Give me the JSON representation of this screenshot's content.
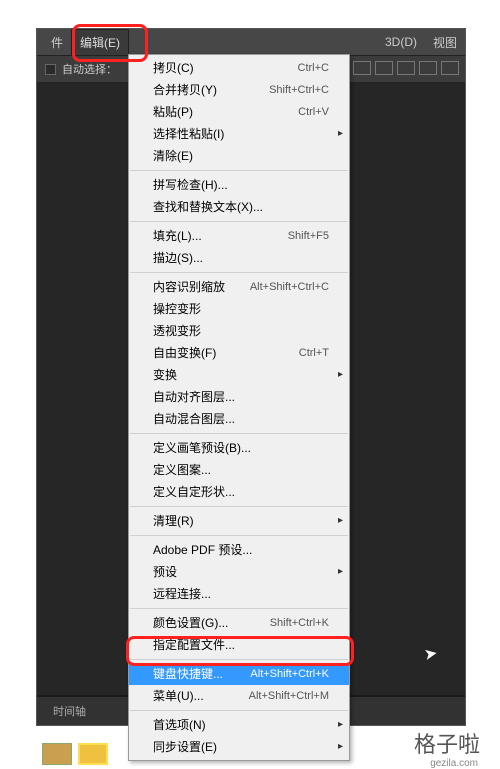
{
  "menubar": {
    "file": "件",
    "edit": "编辑(E)",
    "threeD": "3D(D)",
    "view": "视图"
  },
  "toolbar": {
    "autoSelect": "自动选择：",
    "timeline": "时间轴"
  },
  "menu": {
    "items": [
      {
        "label": "拷贝(C)",
        "sc": "Ctrl+C"
      },
      {
        "label": "合并拷贝(Y)",
        "sc": "Shift+Ctrl+C"
      },
      {
        "label": "粘贴(P)",
        "sc": "Ctrl+V"
      },
      {
        "label": "选择性粘贴(I)",
        "sub": true
      },
      {
        "label": "清除(E)"
      },
      {
        "sep": true
      },
      {
        "label": "拼写检查(H)..."
      },
      {
        "label": "查找和替换文本(X)..."
      },
      {
        "sep": true
      },
      {
        "label": "填充(L)...",
        "sc": "Shift+F5"
      },
      {
        "label": "描边(S)..."
      },
      {
        "sep": true
      },
      {
        "label": "内容识别缩放",
        "sc": "Alt+Shift+Ctrl+C"
      },
      {
        "label": "操控变形"
      },
      {
        "label": "透视变形"
      },
      {
        "label": "自由变换(F)",
        "sc": "Ctrl+T"
      },
      {
        "label": "变换",
        "sub": true
      },
      {
        "label": "自动对齐图层..."
      },
      {
        "label": "自动混合图层..."
      },
      {
        "sep": true
      },
      {
        "label": "定义画笔预设(B)..."
      },
      {
        "label": "定义图案..."
      },
      {
        "label": "定义自定形状..."
      },
      {
        "sep": true
      },
      {
        "label": "清理(R)",
        "sub": true
      },
      {
        "sep": true
      },
      {
        "label": "Adobe PDF 预设..."
      },
      {
        "label": "预设",
        "sub": true
      },
      {
        "label": "远程连接..."
      },
      {
        "sep": true
      },
      {
        "label": "颜色设置(G)...",
        "sc": "Shift+Ctrl+K"
      },
      {
        "label": "指定配置文件..."
      },
      {
        "sep": true
      },
      {
        "label": "键盘快捷键...",
        "sc": "Alt+Shift+Ctrl+K",
        "sel": true
      },
      {
        "label": "菜单(U)...",
        "sc": "Alt+Shift+Ctrl+M"
      },
      {
        "sep": true
      },
      {
        "label": "首选项(N)",
        "sub": true
      },
      {
        "label": "同步设置(E)",
        "sub": true
      }
    ]
  },
  "watermark": {
    "brand": "格子啦",
    "url": "gezila.com"
  }
}
